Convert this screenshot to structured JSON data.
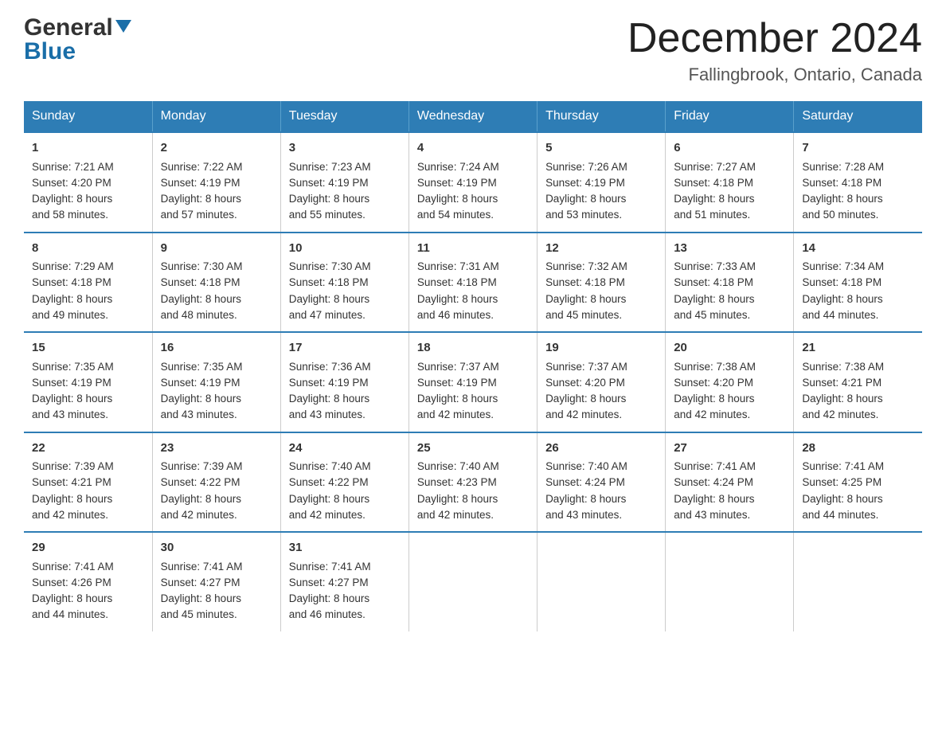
{
  "header": {
    "logo_general": "General",
    "logo_blue": "Blue",
    "month_title": "December 2024",
    "location": "Fallingbrook, Ontario, Canada"
  },
  "calendar": {
    "days": [
      "Sunday",
      "Monday",
      "Tuesday",
      "Wednesday",
      "Thursday",
      "Friday",
      "Saturday"
    ],
    "weeks": [
      [
        {
          "day": "1",
          "sunrise": "7:21 AM",
          "sunset": "4:20 PM",
          "daylight": "8 hours and 58 minutes."
        },
        {
          "day": "2",
          "sunrise": "7:22 AM",
          "sunset": "4:19 PM",
          "daylight": "8 hours and 57 minutes."
        },
        {
          "day": "3",
          "sunrise": "7:23 AM",
          "sunset": "4:19 PM",
          "daylight": "8 hours and 55 minutes."
        },
        {
          "day": "4",
          "sunrise": "7:24 AM",
          "sunset": "4:19 PM",
          "daylight": "8 hours and 54 minutes."
        },
        {
          "day": "5",
          "sunrise": "7:26 AM",
          "sunset": "4:19 PM",
          "daylight": "8 hours and 53 minutes."
        },
        {
          "day": "6",
          "sunrise": "7:27 AM",
          "sunset": "4:18 PM",
          "daylight": "8 hours and 51 minutes."
        },
        {
          "day": "7",
          "sunrise": "7:28 AM",
          "sunset": "4:18 PM",
          "daylight": "8 hours and 50 minutes."
        }
      ],
      [
        {
          "day": "8",
          "sunrise": "7:29 AM",
          "sunset": "4:18 PM",
          "daylight": "8 hours and 49 minutes."
        },
        {
          "day": "9",
          "sunrise": "7:30 AM",
          "sunset": "4:18 PM",
          "daylight": "8 hours and 48 minutes."
        },
        {
          "day": "10",
          "sunrise": "7:30 AM",
          "sunset": "4:18 PM",
          "daylight": "8 hours and 47 minutes."
        },
        {
          "day": "11",
          "sunrise": "7:31 AM",
          "sunset": "4:18 PM",
          "daylight": "8 hours and 46 minutes."
        },
        {
          "day": "12",
          "sunrise": "7:32 AM",
          "sunset": "4:18 PM",
          "daylight": "8 hours and 45 minutes."
        },
        {
          "day": "13",
          "sunrise": "7:33 AM",
          "sunset": "4:18 PM",
          "daylight": "8 hours and 45 minutes."
        },
        {
          "day": "14",
          "sunrise": "7:34 AM",
          "sunset": "4:18 PM",
          "daylight": "8 hours and 44 minutes."
        }
      ],
      [
        {
          "day": "15",
          "sunrise": "7:35 AM",
          "sunset": "4:19 PM",
          "daylight": "8 hours and 43 minutes."
        },
        {
          "day": "16",
          "sunrise": "7:35 AM",
          "sunset": "4:19 PM",
          "daylight": "8 hours and 43 minutes."
        },
        {
          "day": "17",
          "sunrise": "7:36 AM",
          "sunset": "4:19 PM",
          "daylight": "8 hours and 43 minutes."
        },
        {
          "day": "18",
          "sunrise": "7:37 AM",
          "sunset": "4:19 PM",
          "daylight": "8 hours and 42 minutes."
        },
        {
          "day": "19",
          "sunrise": "7:37 AM",
          "sunset": "4:20 PM",
          "daylight": "8 hours and 42 minutes."
        },
        {
          "day": "20",
          "sunrise": "7:38 AM",
          "sunset": "4:20 PM",
          "daylight": "8 hours and 42 minutes."
        },
        {
          "day": "21",
          "sunrise": "7:38 AM",
          "sunset": "4:21 PM",
          "daylight": "8 hours and 42 minutes."
        }
      ],
      [
        {
          "day": "22",
          "sunrise": "7:39 AM",
          "sunset": "4:21 PM",
          "daylight": "8 hours and 42 minutes."
        },
        {
          "day": "23",
          "sunrise": "7:39 AM",
          "sunset": "4:22 PM",
          "daylight": "8 hours and 42 minutes."
        },
        {
          "day": "24",
          "sunrise": "7:40 AM",
          "sunset": "4:22 PM",
          "daylight": "8 hours and 42 minutes."
        },
        {
          "day": "25",
          "sunrise": "7:40 AM",
          "sunset": "4:23 PM",
          "daylight": "8 hours and 42 minutes."
        },
        {
          "day": "26",
          "sunrise": "7:40 AM",
          "sunset": "4:24 PM",
          "daylight": "8 hours and 43 minutes."
        },
        {
          "day": "27",
          "sunrise": "7:41 AM",
          "sunset": "4:24 PM",
          "daylight": "8 hours and 43 minutes."
        },
        {
          "day": "28",
          "sunrise": "7:41 AM",
          "sunset": "4:25 PM",
          "daylight": "8 hours and 44 minutes."
        }
      ],
      [
        {
          "day": "29",
          "sunrise": "7:41 AM",
          "sunset": "4:26 PM",
          "daylight": "8 hours and 44 minutes."
        },
        {
          "day": "30",
          "sunrise": "7:41 AM",
          "sunset": "4:27 PM",
          "daylight": "8 hours and 45 minutes."
        },
        {
          "day": "31",
          "sunrise": "7:41 AM",
          "sunset": "4:27 PM",
          "daylight": "8 hours and 46 minutes."
        },
        null,
        null,
        null,
        null
      ]
    ]
  }
}
